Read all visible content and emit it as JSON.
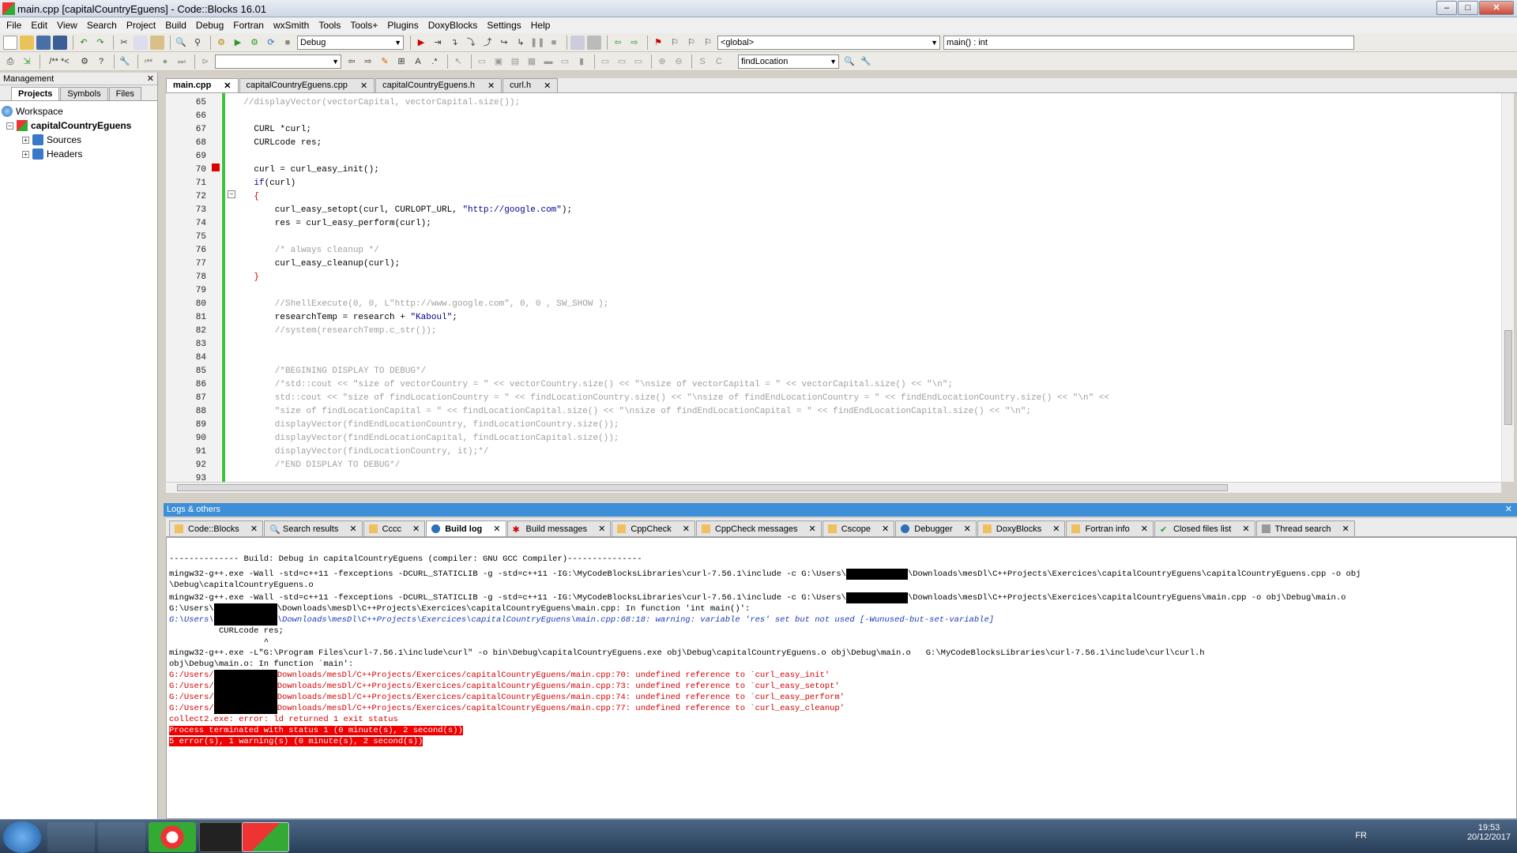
{
  "window": {
    "title": "main.cpp [capitalCountryEguens] - Code::Blocks 16.01",
    "minimize": "–",
    "maximize": "□",
    "close": "✕"
  },
  "menu": [
    "File",
    "Edit",
    "View",
    "Search",
    "Project",
    "Build",
    "Debug",
    "Fortran",
    "wxSmith",
    "Tools",
    "Tools+",
    "Plugins",
    "DoxyBlocks",
    "Settings",
    "Help"
  ],
  "toolbar": {
    "build_target": "Debug",
    "scope": "<global>",
    "function": "main() : int",
    "search_value": "findLocation"
  },
  "management": {
    "title": "Management",
    "close": "✕",
    "tabs": [
      "Projects",
      "Symbols",
      "Files"
    ],
    "workspace": "Workspace",
    "project": "capitalCountryEguens",
    "folders": [
      "Sources",
      "Headers"
    ]
  },
  "editor": {
    "tabs": [
      "main.cpp",
      "capitalCountryEguens.cpp",
      "capitalCountryEguens.h",
      "curl.h"
    ],
    "tab_close": "✕",
    "fold": "−",
    "line_numbers": [
      "65",
      "66",
      "67",
      "68",
      "69",
      "70",
      "71",
      "72",
      "73",
      "74",
      "75",
      "76",
      "77",
      "78",
      "79",
      "80",
      "81",
      "82",
      "83",
      "84",
      "85",
      "86",
      "87",
      "88",
      "89",
      "90",
      "91",
      "92",
      "93"
    ]
  },
  "logs": {
    "title": "Logs & others",
    "close": "✕",
    "tabs": [
      "Code::Blocks",
      "Search results",
      "Cccc",
      "Build log",
      "Build messages",
      "CppCheck",
      "CppCheck messages",
      "Cscope",
      "Debugger",
      "DoxyBlocks",
      "Fortran info",
      "Closed files list",
      "Thread search"
    ],
    "tab_close": "✕",
    "lines": {
      "l1": "-------------- Build: Debug in capitalCountryEguens (compiler: GNU GCC Compiler)---------------",
      "l2a": "mingw32-g++.exe -Wall -std=c++11 -fexceptions -DCURL_STATICLIB -g -std=c++11 -IG:\\MyCodeBlocksLibraries\\curl-7.56.1\\include -c G:\\Users\\",
      "l2b": "\\Downloads\\mesDl\\C++Projects\\Exercices\\capitalCountryEguens\\capitalCountryEguens.cpp -o obj",
      "l3": "\\Debug\\capitalCountryEguens.o",
      "l4a": "mingw32-g++.exe -Wall -std=c++11 -fexceptions -DCURL_STATICLIB -g -std=c++11 -IG:\\MyCodeBlocksLibraries\\curl-7.56.1\\include -c G:\\Users\\",
      "l4b": "\\Downloads\\mesDl\\C++Projects\\Exercices\\capitalCountryEguens\\main.cpp -o obj\\Debug\\main.o",
      "l5a": "G:\\Users\\",
      "l5b": "\\Downloads\\mesDl\\C++Projects\\Exercices\\capitalCountryEguens\\main.cpp: In function 'int main()':",
      "l6a": "G:\\Users\\",
      "l6b": "\\Downloads\\mesDl\\C++Projects\\Exercices\\capitalCountryEguens\\main.cpp:68:18: warning: variable 'res' set but not used [-Wunused-but-set-variable]",
      "l7": "          CURLcode res;",
      "l8": "                   ^",
      "l9": "mingw32-g++.exe -L\"G:\\Program Files\\curl-7.56.1\\include\\curl\" -o bin\\Debug\\capitalCountryEguens.exe obj\\Debug\\capitalCountryEguens.o obj\\Debug\\main.o   G:\\MyCodeBlocksLibraries\\curl-7.56.1\\include\\curl\\curl.h",
      "l10": "obj\\Debug\\main.o: In function `main':",
      "e1a": "G:/Users/",
      "e1b": "Downloads/mesDl/C++Projects/Exercices/capitalCountryEguens/main.cpp:70: undefined reference to `curl_easy_init'",
      "e2a": "G:/Users/",
      "e2b": "Downloads/mesDl/C++Projects/Exercices/capitalCountryEguens/main.cpp:73: undefined reference to `curl_easy_setopt'",
      "e3a": "G:/Users/",
      "e3b": "Downloads/mesDl/C++Projects/Exercices/capitalCountryEguens/main.cpp:74: undefined reference to `curl_easy_perform'",
      "e4a": "G:/Users/",
      "e4b": "Downloads/mesDl/C++Projects/Exercices/capitalCountryEguens/main.cpp:77: undefined reference to `curl_easy_cleanup'",
      "l11": "collect2.exe: error: ld returned 1 exit status",
      "l12": "Process terminated with status 1 (0 minute(s), 2 second(s))",
      "l13": "5 error(s), 1 warning(s) (0 minute(s), 2 second(s))"
    }
  },
  "taskbar": {
    "lang": "FR",
    "time": "19:53",
    "date": "20/12/2017"
  },
  "colors": {
    "accent": "#3c8fd8",
    "error": "#d20000",
    "warning": "#1d3ab8",
    "changed_bar": "#3ec23e"
  }
}
